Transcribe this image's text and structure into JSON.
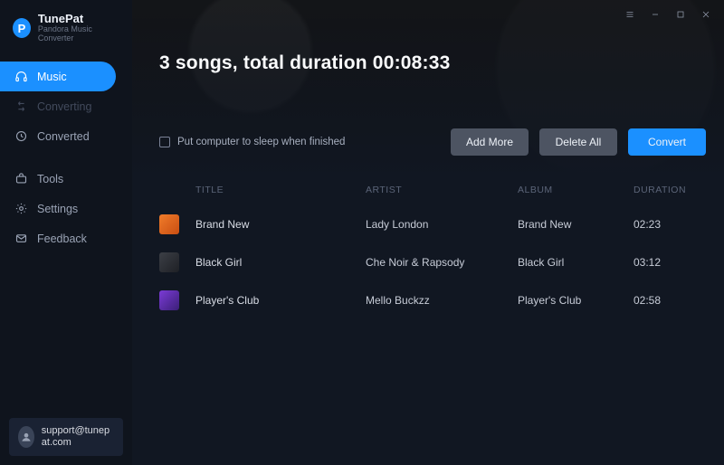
{
  "brand": {
    "name": "TunePat",
    "sub": "Pandora Music Converter",
    "logo_letter": "P"
  },
  "titlebar": {
    "menu": "menu",
    "minimize": "minimize",
    "maximize": "maximize",
    "close": "close"
  },
  "sidebar": {
    "items": [
      {
        "id": "music",
        "label": "Music",
        "active": true
      },
      {
        "id": "converting",
        "label": "Converting",
        "disabled": true
      },
      {
        "id": "converted",
        "label": "Converted"
      }
    ],
    "secondary": [
      {
        "id": "tools",
        "label": "Tools"
      },
      {
        "id": "settings",
        "label": "Settings"
      },
      {
        "id": "feedback",
        "label": "Feedback"
      }
    ]
  },
  "account": {
    "email": "support@tunepat.com"
  },
  "summary": {
    "text": "3 songs, total duration 00:08:33"
  },
  "options": {
    "sleep_label": "Put computer to sleep when finished",
    "sleep_checked": false
  },
  "actions": {
    "add_more": "Add More",
    "delete_all": "Delete All",
    "convert": "Convert"
  },
  "columns": {
    "title": "TITLE",
    "artist": "ARTIST",
    "album": "ALBUM",
    "duration": "DURATION"
  },
  "tracks": [
    {
      "title": "Brand New",
      "artist": "Lady London",
      "album": "Brand New",
      "duration": "02:23"
    },
    {
      "title": "Black Girl",
      "artist": "Che Noir & Rapsody",
      "album": "Black Girl",
      "duration": "03:12"
    },
    {
      "title": "Player's Club",
      "artist": "Mello Buckzz",
      "album": "Player's Club",
      "duration": "02:58"
    }
  ]
}
